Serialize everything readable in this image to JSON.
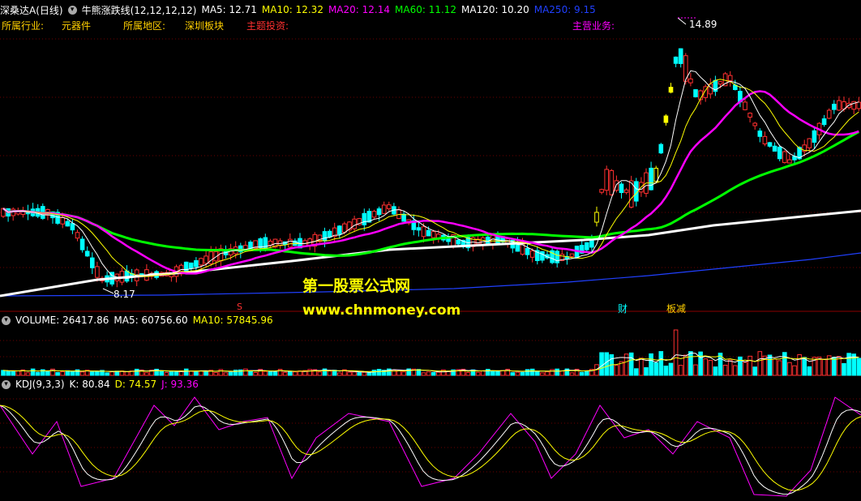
{
  "header": {
    "stock_name": "深桑达A",
    "period": "(日线)",
    "indicator": "牛熊涨跌线(12,12,12,12)",
    "ma": [
      {
        "label": "MA5: 12.71",
        "color": "#ffffff"
      },
      {
        "label": "MA10: 12.32",
        "color": "#ffff00"
      },
      {
        "label": "MA20: 12.14",
        "color": "#ff00ff"
      },
      {
        "label": "MA60: 11.12",
        "color": "#00ff00"
      },
      {
        "label": "MA120: 10.20",
        "color": "#ffffff"
      },
      {
        "label": "MA250: 9.15",
        "color": "#2040ff"
      }
    ]
  },
  "info_row": {
    "industry_label": "所属行业:",
    "industry_value": "元器件",
    "region_label": "所属地区:",
    "region_value": "深圳板块",
    "theme_label": "主题投资:",
    "business_label": "主营业务:"
  },
  "price_chart": {
    "high_label": "14.89",
    "low_label": "8.17",
    "marker_s": "S",
    "marker_cai": "财",
    "marker_ban": "板减"
  },
  "watermark": {
    "line1": "第一股票公式网",
    "line2": "www.chnmoney.com"
  },
  "volume_panel": {
    "label": "VOLUME: 26417.86",
    "ma5": "MA5: 60756.60",
    "ma10": "MA10: 57845.96"
  },
  "kdj_panel": {
    "label": "KDJ(9,3,3)",
    "k": "K: 80.84",
    "d": "D: 74.57",
    "j": "J: 93.36"
  },
  "colors": {
    "up": "#ff3030",
    "down": "#00ffff",
    "ma60": "#00ff00",
    "ma20": "#ff00ff",
    "ma120": "#ffffff",
    "ma250": "#2040ff",
    "grid": "#8b0000",
    "highlight": "#ffff00"
  }
}
